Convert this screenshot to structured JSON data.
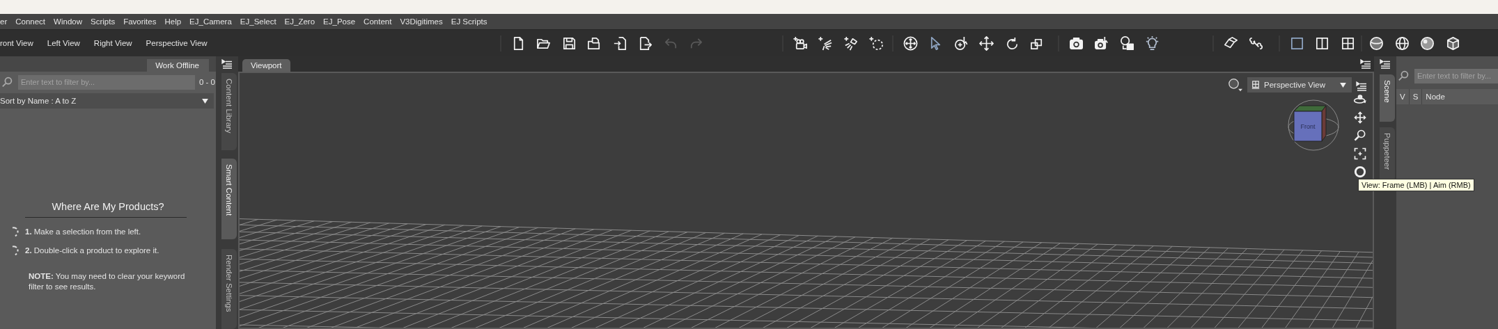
{
  "menu_bar": [
    "er",
    "Connect",
    "Window",
    "Scripts",
    "Favorites",
    "Help",
    "EJ_Camera",
    "EJ_Select",
    "EJ_Zero",
    "EJ_Pose",
    "Content",
    "V3Digitimes",
    "EJ Scripts"
  ],
  "view_buttons": [
    "ront View",
    "Left View",
    "Right View",
    "Perspective View"
  ],
  "toolbar_groups": [
    [
      {
        "kind": "new",
        "selected": false,
        "disabled": false
      },
      {
        "kind": "open",
        "selected": false,
        "disabled": false
      },
      {
        "kind": "save",
        "selected": false,
        "disabled": false
      },
      {
        "kind": "save-as",
        "selected": false,
        "disabled": false
      },
      {
        "kind": "import",
        "selected": false,
        "disabled": false
      },
      {
        "kind": "export",
        "selected": false,
        "disabled": false
      },
      {
        "kind": "undo",
        "selected": false,
        "disabled": true
      },
      {
        "kind": "redo",
        "selected": false,
        "disabled": true
      }
    ],
    [
      {
        "kind": "create-camera",
        "selected": false,
        "disabled": false
      },
      {
        "kind": "create-light",
        "selected": false,
        "disabled": false
      },
      {
        "kind": "create-spotlight",
        "selected": false,
        "disabled": false
      },
      {
        "kind": "create-null",
        "selected": false,
        "disabled": false
      }
    ],
    [
      {
        "kind": "universal",
        "selected": false,
        "disabled": false
      },
      {
        "kind": "select",
        "selected": true,
        "disabled": false
      },
      {
        "kind": "orbit-tool",
        "selected": false,
        "disabled": false
      },
      {
        "kind": "translate",
        "selected": false,
        "disabled": false
      },
      {
        "kind": "rotate",
        "selected": false,
        "disabled": false
      },
      {
        "kind": "scale",
        "selected": false,
        "disabled": false
      }
    ],
    [
      {
        "kind": "render",
        "selected": false,
        "disabled": false
      },
      {
        "kind": "render-settings",
        "selected": false,
        "disabled": false
      },
      {
        "kind": "save-render",
        "selected": false,
        "disabled": false
      },
      {
        "kind": "bulb",
        "selected": false,
        "disabled": false
      }
    ],
    [
      {
        "kind": "surface",
        "selected": false,
        "disabled": false
      },
      {
        "kind": "bone",
        "selected": false,
        "disabled": false
      }
    ],
    [
      {
        "kind": "pane-one",
        "selected": true,
        "disabled": false
      },
      {
        "kind": "pane-two",
        "selected": false,
        "disabled": false
      },
      {
        "kind": "pane-four",
        "selected": false,
        "disabled": false
      }
    ],
    [
      {
        "kind": "sphere-shaded",
        "selected": false,
        "disabled": false
      },
      {
        "kind": "sphere-wire",
        "selected": false,
        "disabled": false
      },
      {
        "kind": "sphere-smooth",
        "selected": false,
        "disabled": false
      },
      {
        "kind": "cube",
        "selected": false,
        "disabled": false
      }
    ]
  ],
  "content_panel": {
    "tab": "Work Offline",
    "filter": {
      "placeholder": "Enter text to filter by..."
    },
    "count": "0 - 0",
    "sort": "Sort by Name : A to Z",
    "heading": "Where Are My Products?",
    "steps": [
      "**1.** Make a selection from the left.",
      "**2.** Double-click a product to explore it."
    ],
    "note": "**NOTE:** You may need to clear your keyword filter to see results."
  },
  "left_tabs": [
    {
      "label": "Content Library",
      "selected": false
    },
    {
      "label": "Smart Content",
      "selected": true
    },
    {
      "label": "Render Settings",
      "selected": false
    }
  ],
  "viewport_tabs": [
    {
      "label": "Viewport",
      "selected": true
    }
  ],
  "viewport": {
    "camera": "Perspective View",
    "cube_label": "Front",
    "tooltip": "View: Frame (LMB) | Aim (RMB)"
  },
  "right_tabs": [
    {
      "label": "Scene",
      "selected": true
    },
    {
      "label": "Puppeteer",
      "selected": false
    }
  ],
  "scene_panel": {
    "filter": {
      "placeholder": "Enter text to filter by..."
    },
    "columns": [
      "V",
      "S",
      "Node"
    ]
  }
}
